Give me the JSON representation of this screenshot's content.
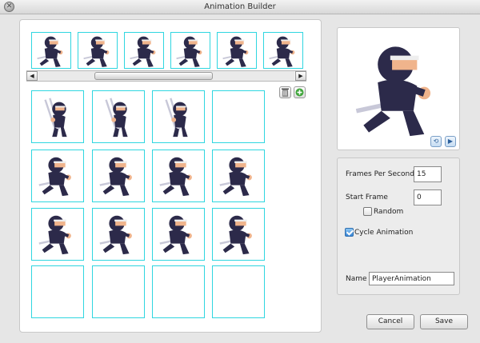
{
  "window": {
    "title": "Animation Builder",
    "close_icon": "close-icon"
  },
  "timeline": {
    "frames": [
      {
        "name": "frame-1",
        "pose": "run"
      },
      {
        "name": "frame-2",
        "pose": "run"
      },
      {
        "name": "frame-3",
        "pose": "run"
      },
      {
        "name": "frame-4",
        "pose": "run"
      },
      {
        "name": "frame-5",
        "pose": "run"
      },
      {
        "name": "frame-6",
        "pose": "run"
      }
    ],
    "scroll_left_glyph": "◀",
    "scroll_right_glyph": "▶"
  },
  "tools": {
    "delete_glyph": "🗑",
    "add_glyph": "+"
  },
  "sprite_grid": {
    "rows": [
      [
        "attack",
        "attack",
        "attack",
        "empty"
      ],
      [
        "run",
        "run",
        "run",
        "run"
      ],
      [
        "run",
        "run",
        "run",
        "run"
      ],
      [
        "empty",
        "empty",
        "empty",
        "empty"
      ]
    ]
  },
  "preview": {
    "pose": "run",
    "rewind_glyph": "⟲",
    "play_glyph": "▶"
  },
  "properties": {
    "fps_label": "Frames Per Second",
    "fps_value": "15",
    "start_frame_label": "Start Frame",
    "start_frame_value": "0",
    "random_label": "Random",
    "random_checked": false,
    "cycle_label": "Cycle Animation",
    "cycle_checked": true,
    "name_label": "Name",
    "name_value": "PlayerAnimation"
  },
  "buttons": {
    "cancel": "Cancel",
    "save": "Save"
  },
  "colors": {
    "accent_border": "#2fd6e0",
    "ninja_body": "#2c2a4a",
    "ninja_face": "#f0b48c",
    "blade": "#c8c8d8"
  }
}
